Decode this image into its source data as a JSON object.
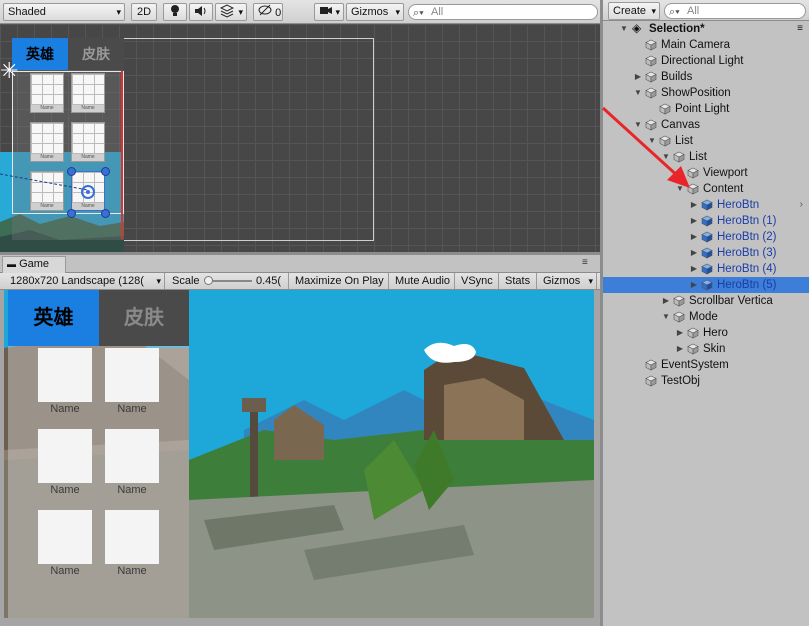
{
  "scene_toolbar": {
    "shading_mode": "Shaded",
    "mode_2d": "2D",
    "audio_icon": "speaker-icon",
    "light_icon": "bulb-icon",
    "effects_icon": "effects-icon",
    "hidden_count": "0",
    "camera_icon": "camera-icon",
    "gizmos": "Gizmos",
    "search_placeholder": "All"
  },
  "scene_ui": {
    "tab_hero": "英雄",
    "tab_skin": "皮肤",
    "tile_label": "Name"
  },
  "game": {
    "tab_label": "Game",
    "resolution": "1280x720 Landscape (128(",
    "scale_label": "Scale",
    "scale_value": "0.45(",
    "maximize": "Maximize On Play",
    "mute": "Mute Audio",
    "vsync": "VSync",
    "stats": "Stats",
    "gizmos": "Gizmos",
    "tab_hero": "英雄",
    "tab_skin": "皮肤",
    "tiles": [
      "Name",
      "Name",
      "Name",
      "Name",
      "Name",
      "Name"
    ]
  },
  "hierarchy": {
    "create": "Create",
    "search_placeholder": "All",
    "scene_name": "Selection*",
    "items": [
      {
        "label": "Main Camera",
        "depth": 1,
        "arrow": ""
      },
      {
        "label": "Directional Light",
        "depth": 1,
        "arrow": ""
      },
      {
        "label": "Builds",
        "depth": 1,
        "arrow": "right"
      },
      {
        "label": "ShowPosition",
        "depth": 1,
        "arrow": "down"
      },
      {
        "label": "Point Light",
        "depth": 2,
        "arrow": ""
      },
      {
        "label": "Canvas",
        "depth": 1,
        "arrow": "down"
      },
      {
        "label": "List",
        "depth": 2,
        "arrow": "down"
      },
      {
        "label": "List",
        "depth": 3,
        "arrow": "down"
      },
      {
        "label": "Viewport",
        "depth": 4,
        "arrow": ""
      },
      {
        "label": "Content",
        "depth": 4,
        "arrow": "down"
      },
      {
        "label": "HeroBtn",
        "depth": 5,
        "arrow": "right",
        "prefab": true
      },
      {
        "label": "HeroBtn (1)",
        "depth": 5,
        "arrow": "right",
        "prefab": true
      },
      {
        "label": "HeroBtn (2)",
        "depth": 5,
        "arrow": "right",
        "prefab": true
      },
      {
        "label": "HeroBtn (3)",
        "depth": 5,
        "arrow": "right",
        "prefab": true
      },
      {
        "label": "HeroBtn (4)",
        "depth": 5,
        "arrow": "right",
        "prefab": true
      },
      {
        "label": "HeroBtn (5)",
        "depth": 5,
        "arrow": "right",
        "prefab": true,
        "selected": true
      },
      {
        "label": "Scrollbar Vertica",
        "depth": 3,
        "arrow": "right"
      },
      {
        "label": "Mode",
        "depth": 3,
        "arrow": "down"
      },
      {
        "label": "Hero",
        "depth": 4,
        "arrow": "right"
      },
      {
        "label": "Skin",
        "depth": 4,
        "arrow": "right"
      },
      {
        "label": "EventSystem",
        "depth": 1,
        "arrow": ""
      },
      {
        "label": "TestObj",
        "depth": 1,
        "arrow": ""
      }
    ]
  },
  "colors": {
    "selection": "#3d7ed8",
    "prefab_text": "#1c3da8",
    "hero_tab": "#1a7fe0",
    "annotation_arrow": "#e8262a"
  }
}
